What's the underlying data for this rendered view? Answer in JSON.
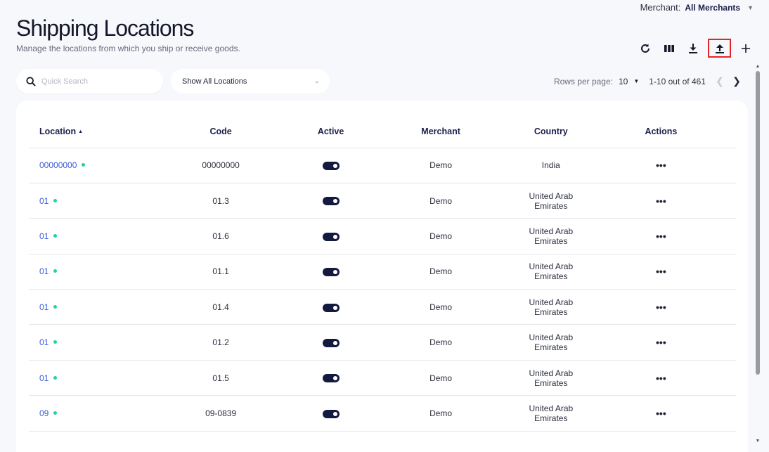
{
  "merchant": {
    "label": "Merchant:",
    "value": "All Merchants"
  },
  "page": {
    "title": "Shipping Locations",
    "subtitle": "Manage the locations from which you ship or receive goods."
  },
  "toolbar": {
    "icons": [
      "refresh-icon",
      "columns-icon",
      "download-icon",
      "upload-icon",
      "add-icon"
    ]
  },
  "search": {
    "placeholder": "Quick Search"
  },
  "filter": {
    "selected": "Show All Locations"
  },
  "pagination": {
    "rows_label": "Rows per page:",
    "rows_value": "10",
    "range": "1-10 out of 461"
  },
  "table": {
    "headers": {
      "location": "Location",
      "code": "Code",
      "active": "Active",
      "merchant": "Merchant",
      "country": "Country",
      "actions": "Actions"
    },
    "rows": [
      {
        "location": "00000000",
        "code": "00000000",
        "active": true,
        "merchant": "Demo",
        "country": "India"
      },
      {
        "location": "01",
        "code": "01.3",
        "active": true,
        "merchant": "Demo",
        "country": "United Arab Emirates"
      },
      {
        "location": "01",
        "code": "01.6",
        "active": true,
        "merchant": "Demo",
        "country": "United Arab Emirates"
      },
      {
        "location": "01",
        "code": "01.1",
        "active": true,
        "merchant": "Demo",
        "country": "United Arab Emirates"
      },
      {
        "location": "01",
        "code": "01.4",
        "active": true,
        "merchant": "Demo",
        "country": "United Arab Emirates"
      },
      {
        "location": "01",
        "code": "01.2",
        "active": true,
        "merchant": "Demo",
        "country": "United Arab Emirates"
      },
      {
        "location": "01",
        "code": "01.5",
        "active": true,
        "merchant": "Demo",
        "country": "United Arab Emirates"
      },
      {
        "location": "09",
        "code": "09-0839",
        "active": true,
        "merchant": "Demo",
        "country": "United Arab Emirates"
      }
    ]
  },
  "colors": {
    "link": "#3a5bd9",
    "status_dot": "#22d3a0",
    "toggle": "#141a3f",
    "highlight": "#e3242b"
  }
}
